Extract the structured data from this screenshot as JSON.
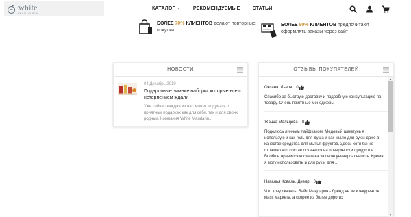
{
  "logo": {
    "word": "white",
    "sub": "MANDARIN"
  },
  "nav": [
    {
      "label": "КАТАЛОГ",
      "has_dropdown": true
    },
    {
      "label": "РЕКОМЕНДУЕМЫЕ"
    },
    {
      "label": "СТАТЬИ"
    }
  ],
  "header_icons": [
    "search-icon",
    "user-icon",
    "cart-icon"
  ],
  "promo": [
    {
      "prefix": "БОЛЕЕ ",
      "highlight": "70%",
      "bold": " КЛИЕНТОВ",
      "rest": " делают повторные покупки"
    },
    {
      "prefix": "БОЛЕЕ ",
      "highlight": "60%",
      "bold": " КЛИЕНТОВ",
      "rest": " предпочитают оформлять заказы через сайт"
    }
  ],
  "news": {
    "title": "НОВОСТИ",
    "items": [
      {
        "date": "04 Декабрь 2019",
        "title": "Подарочные зимние наборы, которые все с нетерпением ждали",
        "excerpt": "Уже сейчас каждая из нас может подумать о приятных подарках как для себя, так и для своих родных. Компания White Mandarin..."
      }
    ]
  },
  "reviews": {
    "title": "ОТЗЫВЫ ПОКУПАТЕЛЕЙ",
    "items": [
      {
        "author": "Оксана, Львов",
        "likes": "0",
        "text": "Спасибо за быструю доставку и подробную консультацию по товару. Очень приятные менеджеры"
      },
      {
        "author": "Жанна Мальцева",
        "likes": "0",
        "text": "Поделюсь личным лайфхаком. Медовый шампунь я использую и как гель для душа и как мыло для рук и даже в качестве средства для мытья фруктов. Здесь хотя бы не страшно что состав останется на поверхности продуктов. Вообще нравится косметика за свою универсальность. Крема я могу использовать и для рук и для ..."
      },
      {
        "author": "Наталья Коваль, Днепр",
        "likes": "0",
        "text": "Что хочу сказать. Вайт Мандарин - бренд не из конкурентов масс маркета, а скорее из более дорогих"
      }
    ]
  },
  "colors": {
    "accent": "#c9953d",
    "text": "#333333",
    "muted": "#888888"
  }
}
